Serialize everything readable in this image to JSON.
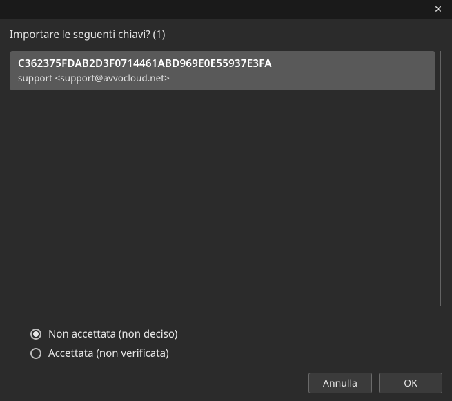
{
  "header": {
    "close_symbol": "✕"
  },
  "prompt": "Importare le seguenti chiavi? (1)",
  "keys": [
    {
      "fingerprint": "C362375FDAB2D3F0714461ABD969E0E55937E3FA",
      "uid": "support <support@avvocloud.net>"
    }
  ],
  "options": {
    "not_accepted_label": "Non accettata (non deciso)",
    "accepted_label": "Accettata (non verificata)",
    "selected": "not_accepted"
  },
  "buttons": {
    "cancel": "Annulla",
    "ok": "OK"
  }
}
